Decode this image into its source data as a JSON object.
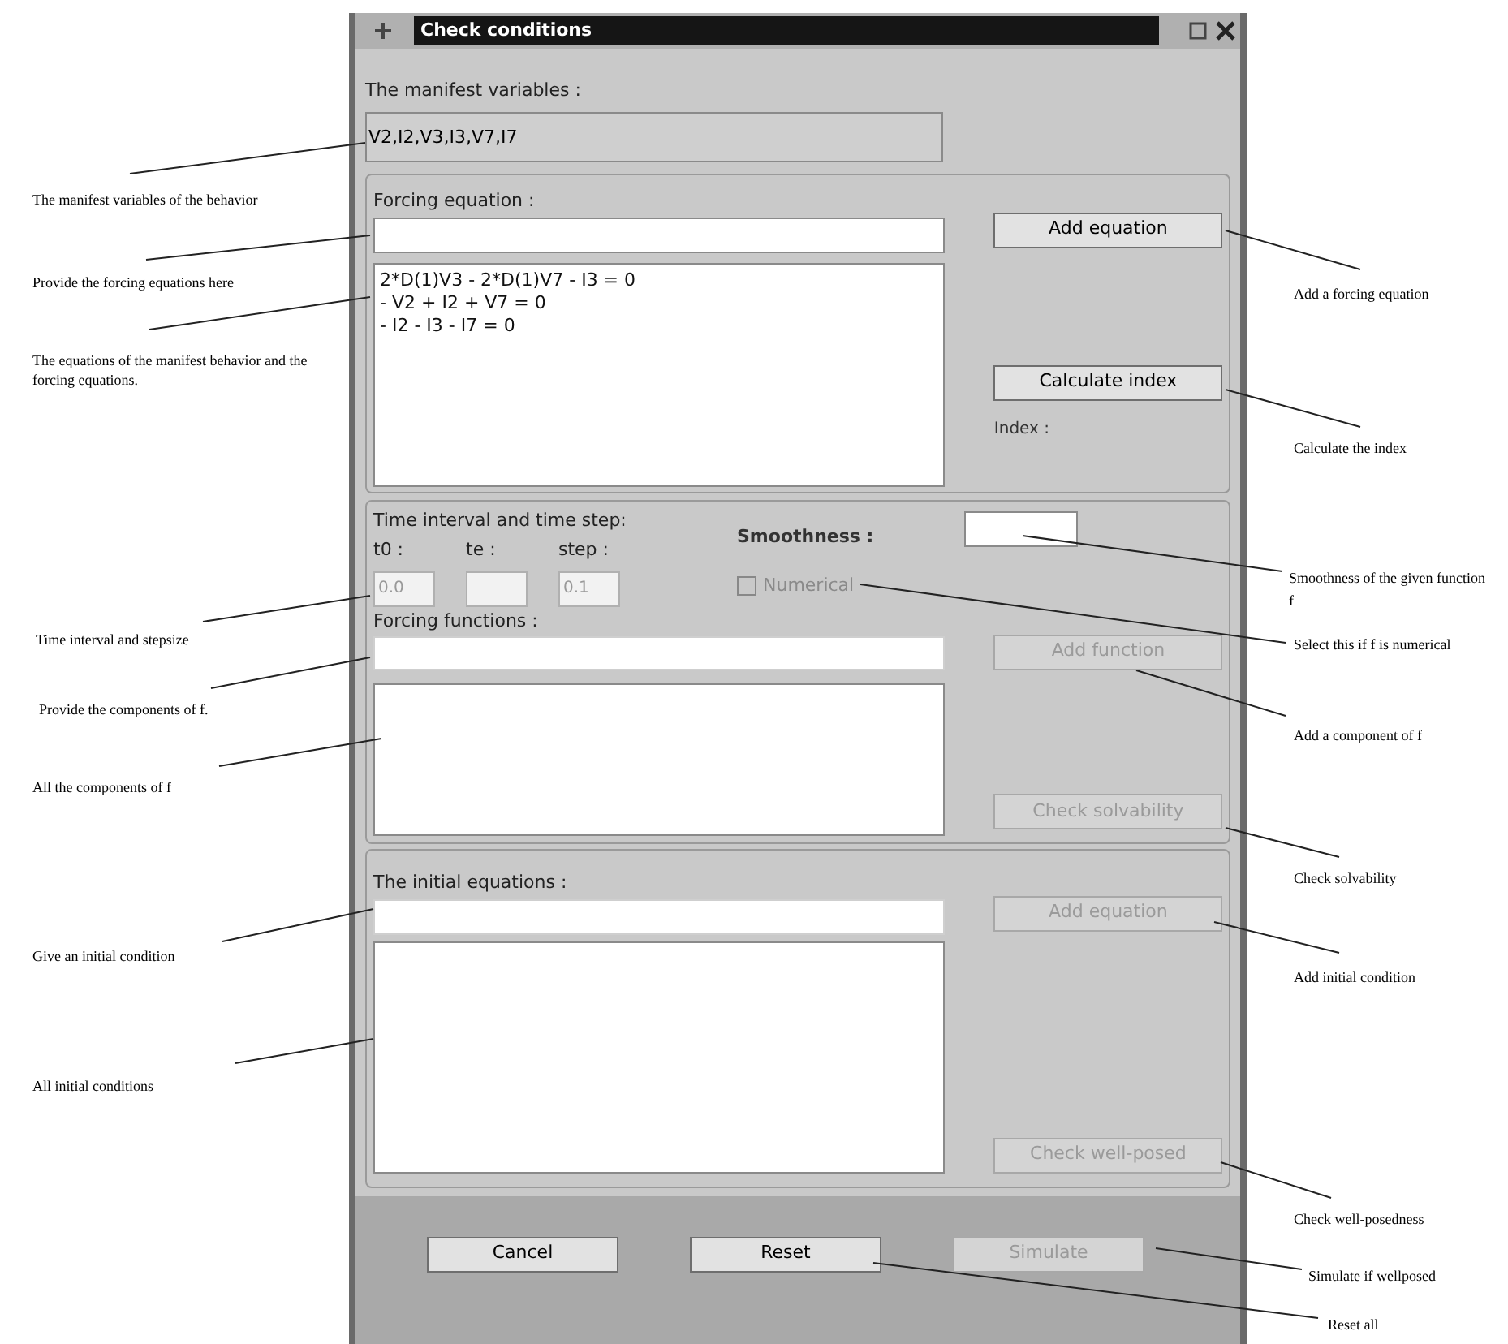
{
  "window": {
    "title": "Check conditions"
  },
  "manifest": {
    "label": "The manifest variables :",
    "value": "V2,I2,V3,I3,V7,I7"
  },
  "forcing_equation": {
    "label": "Forcing equation :",
    "equations": [
      "2*D(1)V3 - 2*D(1)V7 - I3 = 0",
      "- V2 + I2 + V7 = 0",
      "- I2 - I3 - I7 = 0"
    ],
    "add_button": {
      "label": "Add equation",
      "disabled": false
    },
    "index_button": {
      "label": "Calculate index",
      "disabled": false
    },
    "index_label": "Index :"
  },
  "time": {
    "label": "Time interval and time step:",
    "fields": [
      {
        "label": "t0 :",
        "value": "0.0"
      },
      {
        "label": "te :"
      },
      {
        "label": "step :",
        "value": "0.1"
      }
    ],
    "smoothness_label": "Smoothness :",
    "numerical": {
      "label": "Numerical",
      "checked": false,
      "disabled": true
    },
    "forcing_functions_label": "Forcing functions :",
    "add_button": {
      "label": "Add function",
      "disabled": true
    },
    "solvability_button": {
      "label": "Check solvability",
      "disabled": true
    }
  },
  "initial": {
    "label": "The initial equations :",
    "add_button": {
      "label": "Add equation",
      "disabled": true
    },
    "check_button": {
      "label": "Check well-posed",
      "disabled": true
    }
  },
  "footer_buttons": [
    {
      "label": "Cancel",
      "disabled": false
    },
    {
      "label": "Reset",
      "disabled": false
    },
    {
      "label": "Simulate",
      "disabled": true
    }
  ],
  "annotations_left": [
    "The manifest variables of the behavior",
    "Provide the forcing equations here",
    "The equations of the manifest behavior and the forcing equations.",
    "Time interval and stepsize",
    "Provide the components of f.",
    "All the components of f",
    "Give an initial condition",
    "All initial conditions"
  ],
  "annotations_right": [
    "Add a forcing equation",
    "Calculate the index",
    "Smoothness of the given function f",
    "Select this if f is numerical",
    "Add a component of f",
    "Check solvability",
    "Add initial condition",
    "Check well-posedness",
    "Simulate if wellposed",
    "Reset all"
  ]
}
